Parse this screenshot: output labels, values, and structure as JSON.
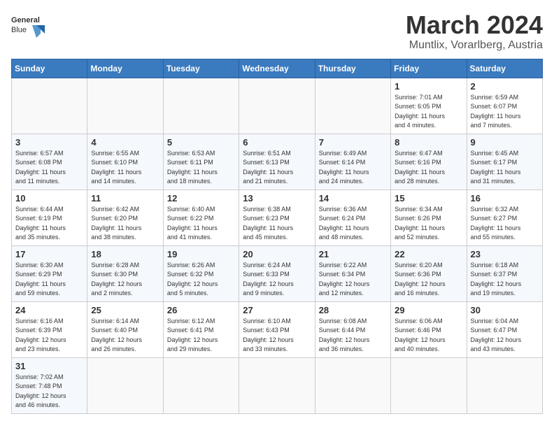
{
  "header": {
    "logo_general": "General",
    "logo_blue": "Blue",
    "month_year": "March 2024",
    "location": "Muntlix, Vorarlberg, Austria"
  },
  "weekdays": [
    "Sunday",
    "Monday",
    "Tuesday",
    "Wednesday",
    "Thursday",
    "Friday",
    "Saturday"
  ],
  "weeks": [
    [
      {
        "day": "",
        "info": ""
      },
      {
        "day": "",
        "info": ""
      },
      {
        "day": "",
        "info": ""
      },
      {
        "day": "",
        "info": ""
      },
      {
        "day": "",
        "info": ""
      },
      {
        "day": "1",
        "info": "Sunrise: 7:01 AM\nSunset: 6:05 PM\nDaylight: 11 hours\nand 4 minutes."
      },
      {
        "day": "2",
        "info": "Sunrise: 6:59 AM\nSunset: 6:07 PM\nDaylight: 11 hours\nand 7 minutes."
      }
    ],
    [
      {
        "day": "3",
        "info": "Sunrise: 6:57 AM\nSunset: 6:08 PM\nDaylight: 11 hours\nand 11 minutes."
      },
      {
        "day": "4",
        "info": "Sunrise: 6:55 AM\nSunset: 6:10 PM\nDaylight: 11 hours\nand 14 minutes."
      },
      {
        "day": "5",
        "info": "Sunrise: 6:53 AM\nSunset: 6:11 PM\nDaylight: 11 hours\nand 18 minutes."
      },
      {
        "day": "6",
        "info": "Sunrise: 6:51 AM\nSunset: 6:13 PM\nDaylight: 11 hours\nand 21 minutes."
      },
      {
        "day": "7",
        "info": "Sunrise: 6:49 AM\nSunset: 6:14 PM\nDaylight: 11 hours\nand 24 minutes."
      },
      {
        "day": "8",
        "info": "Sunrise: 6:47 AM\nSunset: 6:16 PM\nDaylight: 11 hours\nand 28 minutes."
      },
      {
        "day": "9",
        "info": "Sunrise: 6:45 AM\nSunset: 6:17 PM\nDaylight: 11 hours\nand 31 minutes."
      }
    ],
    [
      {
        "day": "10",
        "info": "Sunrise: 6:44 AM\nSunset: 6:19 PM\nDaylight: 11 hours\nand 35 minutes."
      },
      {
        "day": "11",
        "info": "Sunrise: 6:42 AM\nSunset: 6:20 PM\nDaylight: 11 hours\nand 38 minutes."
      },
      {
        "day": "12",
        "info": "Sunrise: 6:40 AM\nSunset: 6:22 PM\nDaylight: 11 hours\nand 41 minutes."
      },
      {
        "day": "13",
        "info": "Sunrise: 6:38 AM\nSunset: 6:23 PM\nDaylight: 11 hours\nand 45 minutes."
      },
      {
        "day": "14",
        "info": "Sunrise: 6:36 AM\nSunset: 6:24 PM\nDaylight: 11 hours\nand 48 minutes."
      },
      {
        "day": "15",
        "info": "Sunrise: 6:34 AM\nSunset: 6:26 PM\nDaylight: 11 hours\nand 52 minutes."
      },
      {
        "day": "16",
        "info": "Sunrise: 6:32 AM\nSunset: 6:27 PM\nDaylight: 11 hours\nand 55 minutes."
      }
    ],
    [
      {
        "day": "17",
        "info": "Sunrise: 6:30 AM\nSunset: 6:29 PM\nDaylight: 11 hours\nand 59 minutes."
      },
      {
        "day": "18",
        "info": "Sunrise: 6:28 AM\nSunset: 6:30 PM\nDaylight: 12 hours\nand 2 minutes."
      },
      {
        "day": "19",
        "info": "Sunrise: 6:26 AM\nSunset: 6:32 PM\nDaylight: 12 hours\nand 5 minutes."
      },
      {
        "day": "20",
        "info": "Sunrise: 6:24 AM\nSunset: 6:33 PM\nDaylight: 12 hours\nand 9 minutes."
      },
      {
        "day": "21",
        "info": "Sunrise: 6:22 AM\nSunset: 6:34 PM\nDaylight: 12 hours\nand 12 minutes."
      },
      {
        "day": "22",
        "info": "Sunrise: 6:20 AM\nSunset: 6:36 PM\nDaylight: 12 hours\nand 16 minutes."
      },
      {
        "day": "23",
        "info": "Sunrise: 6:18 AM\nSunset: 6:37 PM\nDaylight: 12 hours\nand 19 minutes."
      }
    ],
    [
      {
        "day": "24",
        "info": "Sunrise: 6:16 AM\nSunset: 6:39 PM\nDaylight: 12 hours\nand 23 minutes."
      },
      {
        "day": "25",
        "info": "Sunrise: 6:14 AM\nSunset: 6:40 PM\nDaylight: 12 hours\nand 26 minutes."
      },
      {
        "day": "26",
        "info": "Sunrise: 6:12 AM\nSunset: 6:41 PM\nDaylight: 12 hours\nand 29 minutes."
      },
      {
        "day": "27",
        "info": "Sunrise: 6:10 AM\nSunset: 6:43 PM\nDaylight: 12 hours\nand 33 minutes."
      },
      {
        "day": "28",
        "info": "Sunrise: 6:08 AM\nSunset: 6:44 PM\nDaylight: 12 hours\nand 36 minutes."
      },
      {
        "day": "29",
        "info": "Sunrise: 6:06 AM\nSunset: 6:46 PM\nDaylight: 12 hours\nand 40 minutes."
      },
      {
        "day": "30",
        "info": "Sunrise: 6:04 AM\nSunset: 6:47 PM\nDaylight: 12 hours\nand 43 minutes."
      }
    ],
    [
      {
        "day": "31",
        "info": "Sunrise: 7:02 AM\nSunset: 7:48 PM\nDaylight: 12 hours\nand 46 minutes."
      },
      {
        "day": "",
        "info": ""
      },
      {
        "day": "",
        "info": ""
      },
      {
        "day": "",
        "info": ""
      },
      {
        "day": "",
        "info": ""
      },
      {
        "day": "",
        "info": ""
      },
      {
        "day": "",
        "info": ""
      }
    ]
  ]
}
